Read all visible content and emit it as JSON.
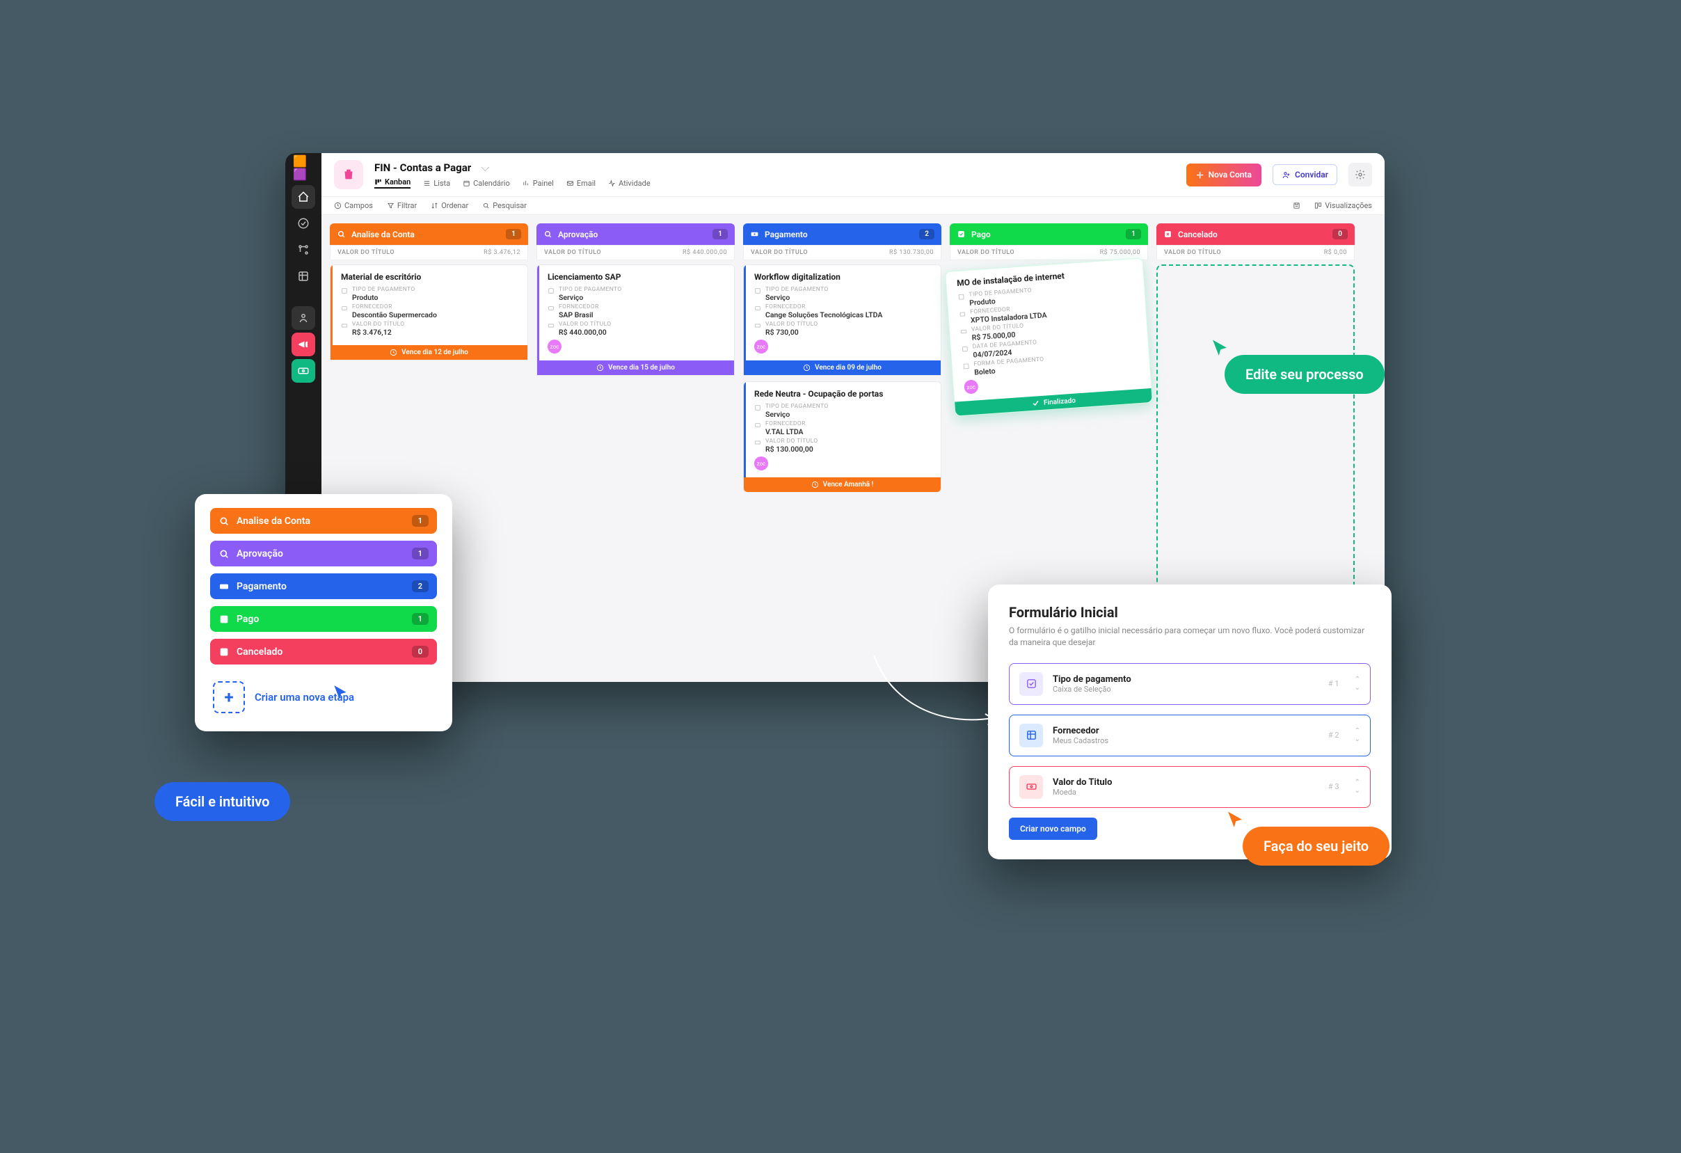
{
  "colors": {
    "orange": "#f97316",
    "purple": "#8b5cf6",
    "blue": "#2563eb",
    "green": "#10b981",
    "red": "#f43f5e"
  },
  "project": {
    "title": "FIN - Contas a Pagar"
  },
  "view_tabs": {
    "kanban": "Kanban",
    "lista": "Lista",
    "calendario": "Calendário",
    "painel": "Painel",
    "email": "Email",
    "atividade": "Atividade"
  },
  "header_actions": {
    "new": "Nova Conta",
    "invite": "Convidar"
  },
  "toolbar": {
    "campos": "Campos",
    "filtrar": "Filtrar",
    "ordenar": "Ordenar",
    "pesquisar": "Pesquisar",
    "visualizacoes": "Visualizações"
  },
  "subheader_label": "VALOR DO TÍTULO",
  "columns": {
    "analise": {
      "title": "Analise da Conta",
      "count": "1",
      "total": "R$ 3.476,12"
    },
    "aprovacao": {
      "title": "Aprovação",
      "count": "1",
      "total": "R$ 440.000,00"
    },
    "pagamento": {
      "title": "Pagamento",
      "count": "2",
      "total": "R$ 130.730,00"
    },
    "pago": {
      "title": "Pago",
      "count": "1",
      "total": "R$ 75.000,00"
    },
    "cancelado": {
      "title": "Cancelado",
      "count": "0",
      "total": "R$ 0,00"
    }
  },
  "card_labels": {
    "tipo": "TIPO DE PAGAMENTO",
    "fornecedor": "FORNECEDOR",
    "valor": "VALOR DO TÍTULO",
    "data": "DATA DE PAGAMENTO",
    "forma": "FORMA DE PAGAMENTO"
  },
  "cards": {
    "c1": {
      "title": "Material de escritório",
      "tipo": "Produto",
      "fornecedor": "Descontão Supermercado",
      "valor": "R$ 3.476,12",
      "due": "Vence dia 12 de julho"
    },
    "c2": {
      "title": "Licenciamento SAP",
      "tipo": "Serviço",
      "fornecedor": "SAP Brasil",
      "valor": "R$ 440.000,00",
      "due": "Vence dia 15 de julho",
      "avatar": "zoc"
    },
    "c3": {
      "title": "Workflow digitalization",
      "tipo": "Serviço",
      "fornecedor": "Cange Soluções Tecnológicas LTDA",
      "valor": "R$ 730,00",
      "due": "Vence dia 09 de julho",
      "avatar": "zoc"
    },
    "c4": {
      "title": "Rede Neutra - Ocupação de portas",
      "tipo": "Serviço",
      "fornecedor": "V.TAL LTDA",
      "valor": "R$ 130.000,00",
      "due": "Vence Amanhã !",
      "avatar": "zoc"
    },
    "c5": {
      "title": "MO de instalação de internet",
      "tipo": "Produto",
      "fornecedor": "XPTO Instaladora LTDA",
      "valor": "R$ 75.000,00",
      "data": "04/07/2024",
      "forma": "Boleto",
      "done": "Finalizado",
      "avatar": "zoc"
    }
  },
  "left_popover": {
    "items": {
      "i1": "Analise da Conta",
      "i2": "Aprovação",
      "i3": "Pagamento",
      "i4": "Pago",
      "i5": "Cancelado"
    },
    "counts": {
      "c1": "1",
      "c2": "1",
      "c3": "2",
      "c4": "1",
      "c5": "0"
    },
    "new_step": "Criar uma nova etapa"
  },
  "right_popover": {
    "title": "Formulário Inicial",
    "sub": "O formulário é o gatilho inicial necessário para começar um novo fluxo. Você poderá customizar da maneira que desejar",
    "fields": {
      "f1": {
        "t": "Tipo de pagamento",
        "s": "Caixa de Seleção",
        "o": "# 1"
      },
      "f2": {
        "t": "Fornecedor",
        "s": "Meus Cadastros",
        "o": "# 2"
      },
      "f3": {
        "t": "Valor do Titulo",
        "s": "Moeda",
        "o": "# 3"
      }
    },
    "btn": "Criar novo campo"
  },
  "pills": {
    "blue": "Fácil e intuitivo",
    "green": "Edite seu processo",
    "orange": "Faça do seu jeito"
  }
}
